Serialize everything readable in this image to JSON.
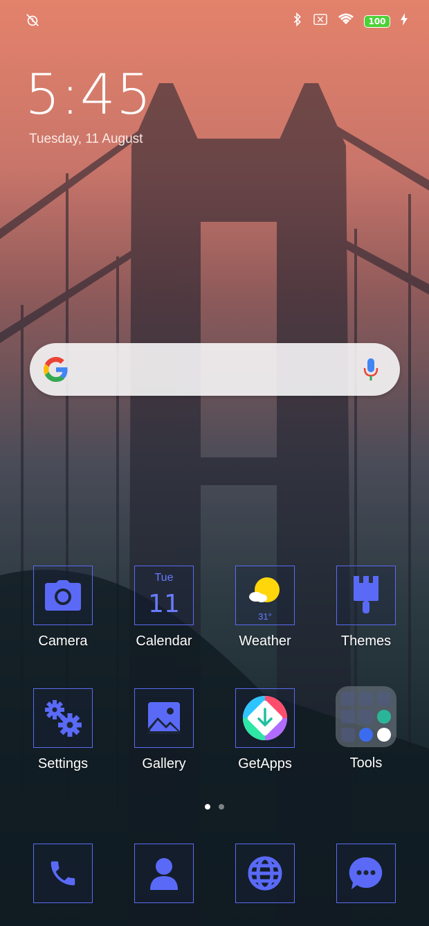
{
  "status_bar": {
    "left_icon": "alarm-off-icon",
    "right_icons": [
      "bluetooth-icon",
      "no-sim-icon",
      "wifi-icon"
    ],
    "battery_level": "100",
    "charging_icon": "charging-bolt-icon"
  },
  "lockclock": {
    "time": "5:45",
    "date": "Tuesday, 11 August"
  },
  "search": {
    "logo": "google-logo",
    "mic_icon": "mic-icon"
  },
  "apps_row1": [
    {
      "label": "Camera",
      "icon": "camera-icon"
    },
    {
      "label": "Calendar",
      "icon": "calendar-icon",
      "day": "Tue",
      "date": "11"
    },
    {
      "label": "Weather",
      "icon": "weather-sun-icon",
      "temp": "31°"
    },
    {
      "label": "Themes",
      "icon": "brush-icon"
    }
  ],
  "apps_row2": [
    {
      "label": "Settings",
      "icon": "gears-icon"
    },
    {
      "label": "Gallery",
      "icon": "image-icon"
    },
    {
      "label": "GetApps",
      "icon": "getapps-icon"
    },
    {
      "label": "Tools",
      "icon": "folder-icon"
    }
  ],
  "pager": {
    "pages": 2,
    "current": 1
  },
  "dock": [
    {
      "name": "phone",
      "icon": "phone-icon"
    },
    {
      "name": "contacts",
      "icon": "contact-icon"
    },
    {
      "name": "browser",
      "icon": "globe-icon"
    },
    {
      "name": "messages",
      "icon": "message-icon"
    }
  ],
  "colors": {
    "accent": "#5b6cf0",
    "icon_blue": "#5a6af7",
    "sun": "#ffd60a"
  }
}
